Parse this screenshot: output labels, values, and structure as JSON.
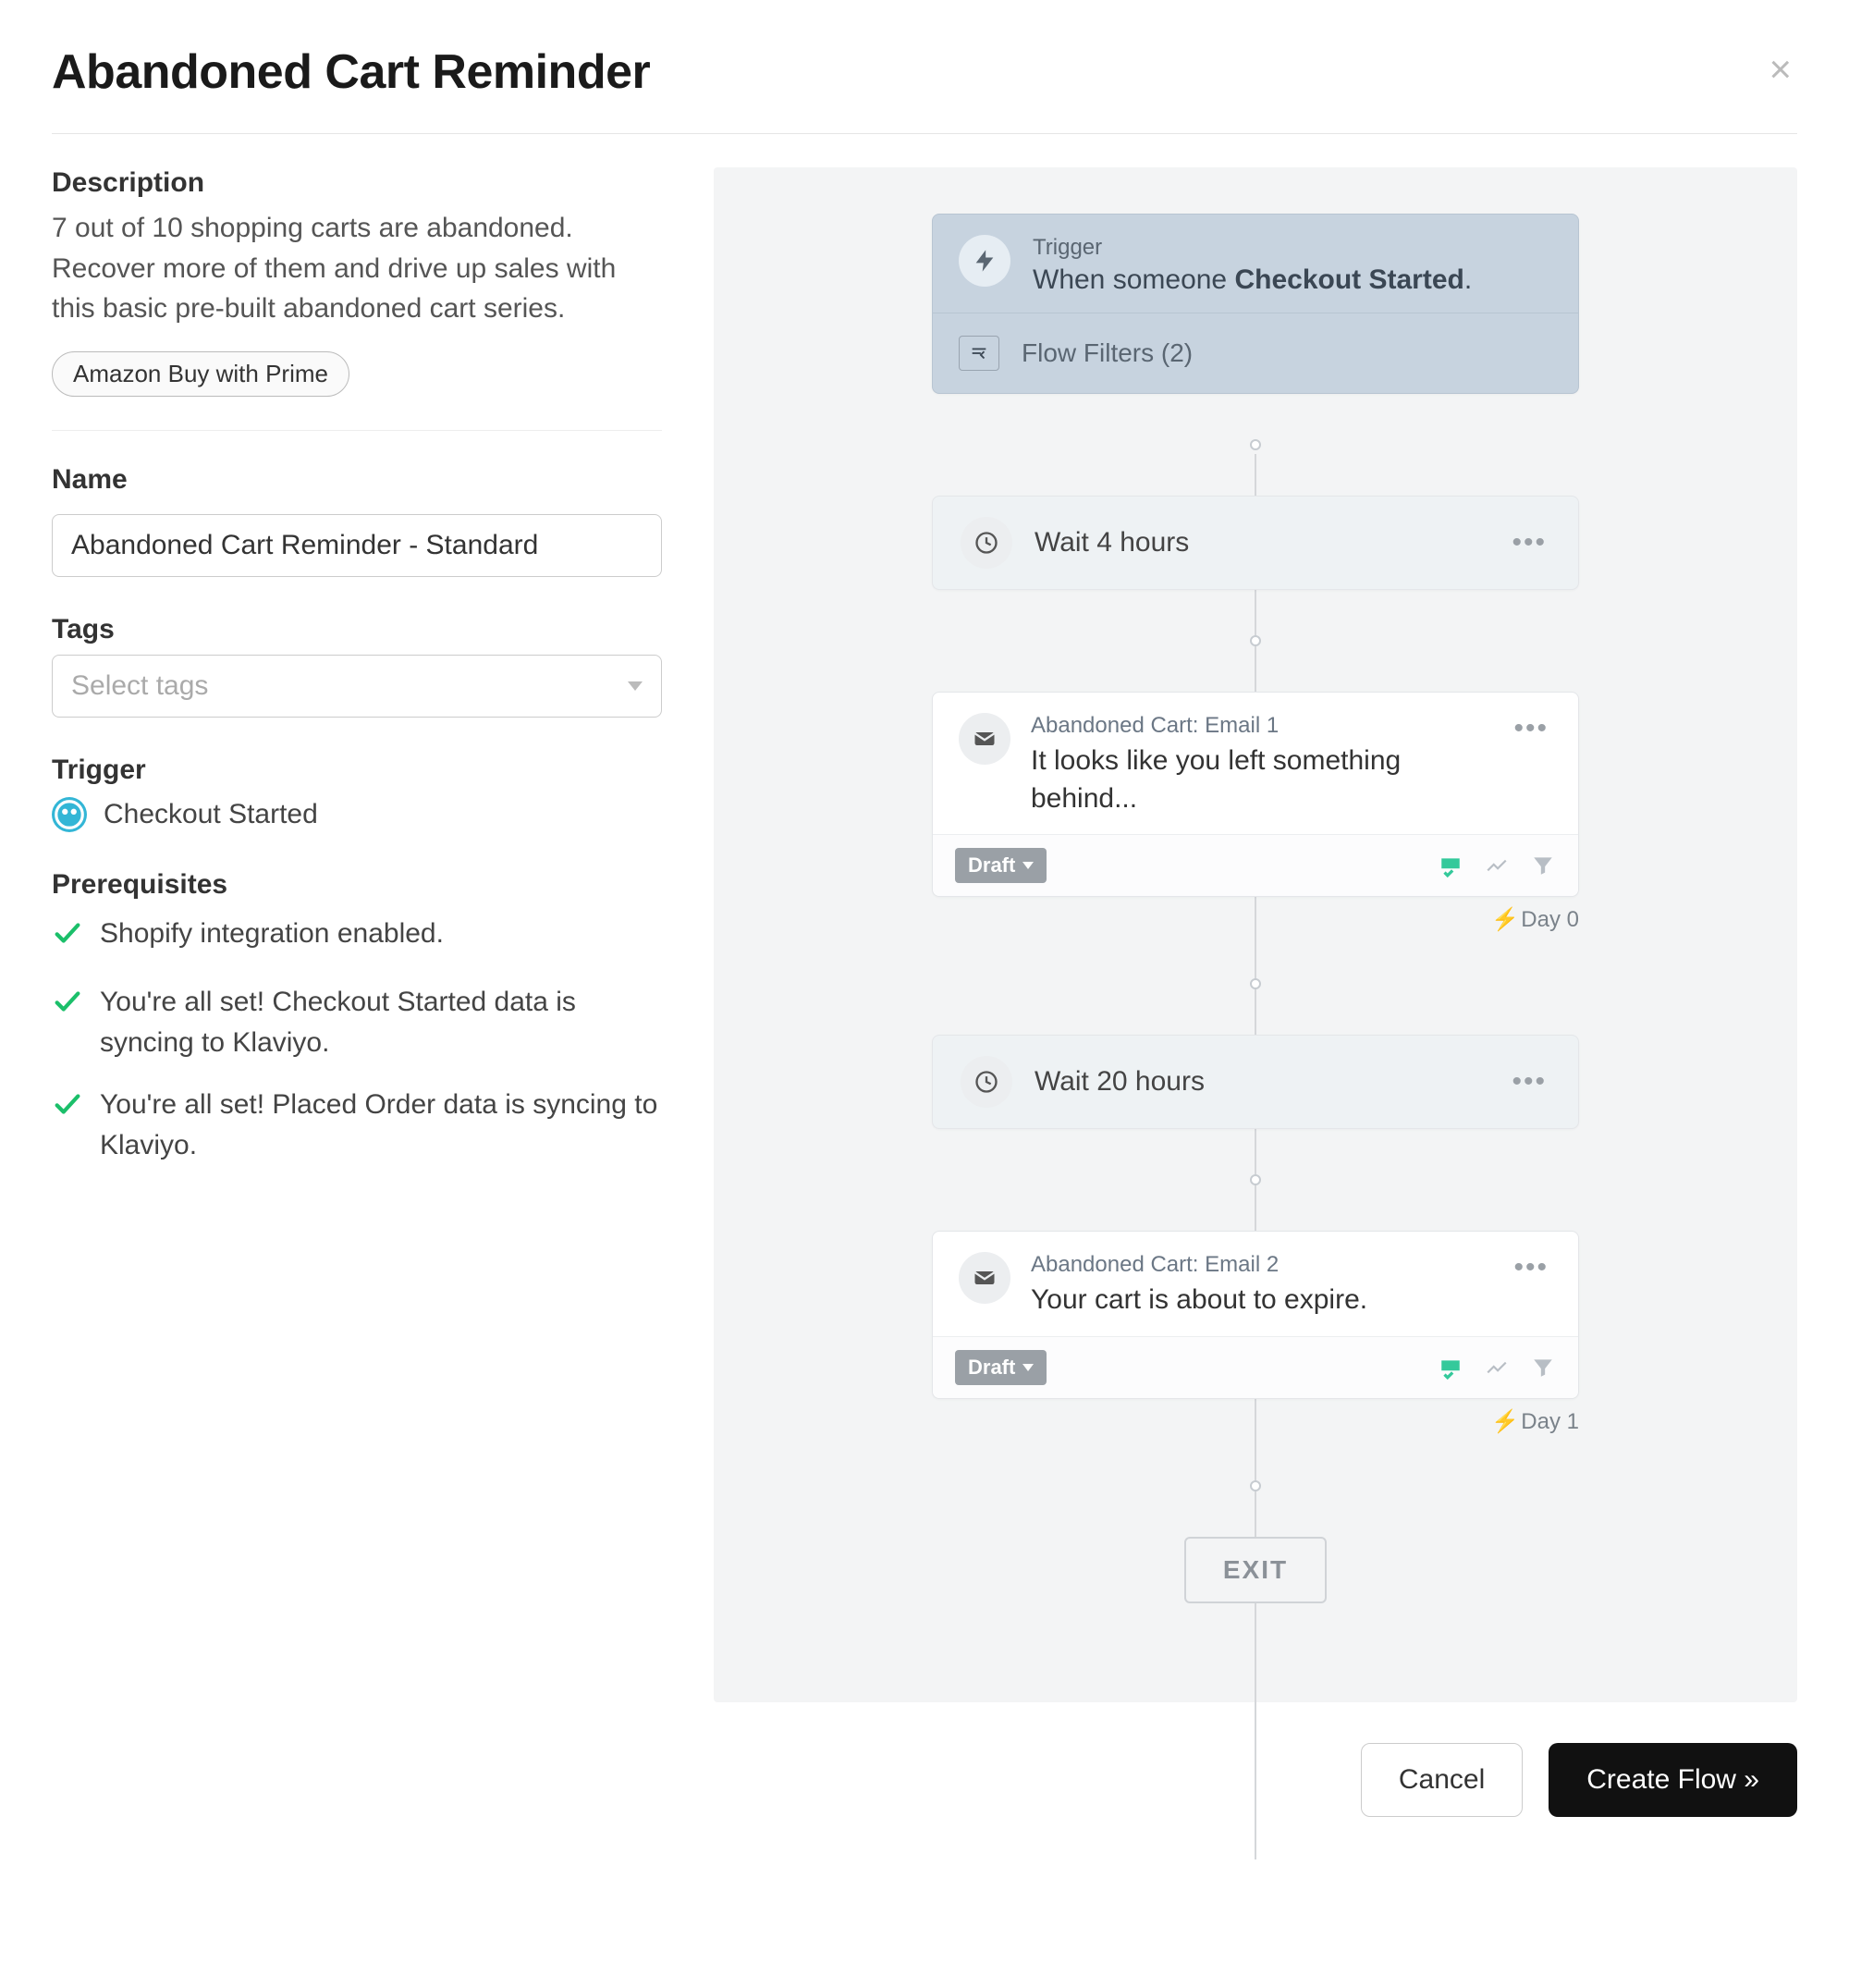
{
  "header": {
    "title": "Abandoned Cart Reminder",
    "close_glyph": "×"
  },
  "left": {
    "description_label": "Description",
    "description_text": "7 out of 10 shopping carts are abandoned. Recover more of them and drive up sales with this basic pre-built abandoned cart series.",
    "integration_pill": "Amazon Buy with Prime",
    "name_label": "Name",
    "name_value": "Abandoned Cart Reminder - Standard",
    "tags_label": "Tags",
    "tags_placeholder": "Select tags",
    "trigger_label": "Trigger",
    "trigger_name": "Checkout Started",
    "prerequisites_label": "Prerequisites",
    "prerequisites": [
      "Shopify integration enabled.",
      "You're all set! Checkout Started data is syncing to Klaviyo.",
      "You're all set! Placed Order data is syncing to Klaviyo."
    ]
  },
  "flow": {
    "trigger_small_label": "Trigger",
    "trigger_prefix": "When someone ",
    "trigger_event": "Checkout Started",
    "trigger_suffix": ".",
    "filters_label": "Flow Filters (2)",
    "wait1": "Wait 4 hours",
    "wait2": "Wait 20 hours",
    "email1_title": "Abandoned Cart: Email 1",
    "email1_subject": "It looks like you left something behind...",
    "email2_title": "Abandoned Cart: Email 2",
    "email2_subject": "Your cart is about to expire.",
    "draft_label": "Draft",
    "day0_label": "Day 0",
    "day1_label": "Day 1",
    "exit_label": "EXIT"
  },
  "footer": {
    "cancel_label": "Cancel",
    "create_label": "Create Flow »"
  }
}
